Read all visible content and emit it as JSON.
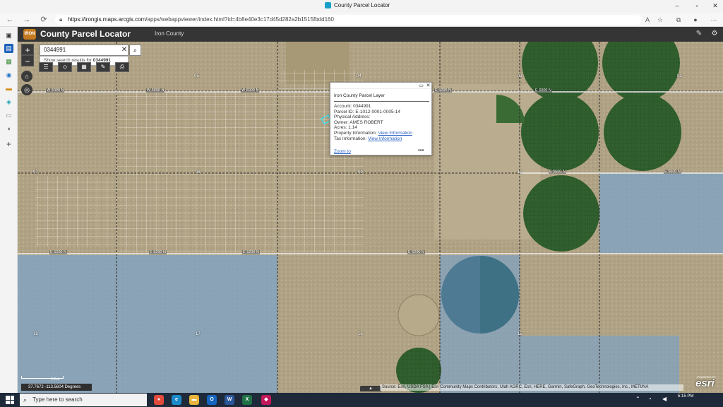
{
  "browser": {
    "tab_title": "County Parcel Locator",
    "url_host": "https://irongis.maps.arcgis.com",
    "url_path": "/apps/webappviewer/index.html?id=4b8e40e3c17d45d282a2b1515fbdd160"
  },
  "app": {
    "logo_text": "IRON",
    "title": "County Parcel Locator",
    "subtitle": "Iron County"
  },
  "search": {
    "value": "0344991",
    "suggestion_prefix": "Show search results for ",
    "suggestion_term": "0344991"
  },
  "map": {
    "section_numbers": {
      "s05": "05",
      "s04": "04",
      "s03": "03",
      "s02": "02",
      "s07": "07",
      "s08": "08",
      "s09": "09",
      "s10": "10",
      "s18": "18",
      "s17": "17",
      "s16": "16",
      "s15": "15"
    },
    "roads": {
      "w6000a": "W 6000 N",
      "w6000b": "W 6000 N",
      "w6000c": "W 6000 N",
      "e6000a": "E 6000 N",
      "e6000b": "E 6000 N",
      "e5600a": "E 5600 N",
      "e5600b": "E 5600 N",
      "e5200a": "E 5200 N",
      "e5200b": "E 5200 N",
      "e5200c": "E 5200 N",
      "e5200d": "E 5200 N"
    },
    "coordinates": "37.7672 -113.5604 Degrees",
    "scale_label": "0.2mi",
    "attribution": "Source: Esri, USDA FSA | Esri Community Maps Contributors, Utah AGRC, Esri, HERE, Garmin, SafeGraph, GeoTechnologies, Inc., METI/NA",
    "esri_logo": "esri",
    "esri_powered": "POWERED BY"
  },
  "popup": {
    "title": "Iron County Parcel Layer",
    "account_label": "Account:",
    "account_value": "0344991",
    "parcel_label": "Parcel ID:",
    "parcel_value": "E-1012-0001-0005-14",
    "address_label": "Physical Address:",
    "owner_label": "Owner:",
    "owner_value": "AMES ROBERT",
    "acres_label": "Acres:",
    "acres_value": "1.14",
    "property_label": "Property Information:",
    "property_link": "View Information",
    "tax_label": "Tax Information:",
    "tax_link": "View Information",
    "zoom_link": "Zoom to",
    "more": "•••"
  },
  "taskbar": {
    "search_placeholder": "Type here to search",
    "time": "5:15 PM"
  }
}
